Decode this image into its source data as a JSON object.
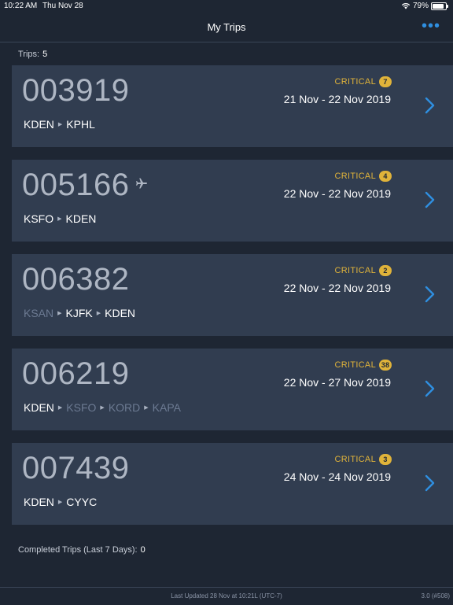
{
  "status_bar": {
    "time": "10:22 AM",
    "date": "Thu Nov 28",
    "battery": "79%"
  },
  "nav": {
    "title": "My Trips",
    "more_icon": "more-dots-icon"
  },
  "trips_count": {
    "label": "Trips:",
    "value": "5"
  },
  "trips": [
    {
      "number": "003919",
      "status": "CRITICAL",
      "critical_count": "7",
      "dates": "21 Nov - 22 Nov 2019",
      "in_flight": false,
      "route": [
        {
          "code": "KDEN",
          "active": true
        },
        {
          "code": "KPHL",
          "active": true
        }
      ]
    },
    {
      "number": "005166",
      "status": "CRITICAL",
      "critical_count": "4",
      "dates": "22 Nov - 22 Nov 2019",
      "in_flight": true,
      "route": [
        {
          "code": "KSFO",
          "active": true
        },
        {
          "code": "KDEN",
          "active": true
        }
      ]
    },
    {
      "number": "006382",
      "status": "CRITICAL",
      "critical_count": "2",
      "dates": "22 Nov - 22 Nov 2019",
      "in_flight": false,
      "route": [
        {
          "code": "KSAN",
          "active": false
        },
        {
          "code": "KJFK",
          "active": true
        },
        {
          "code": "KDEN",
          "active": true
        }
      ]
    },
    {
      "number": "006219",
      "status": "CRITICAL",
      "critical_count": "38",
      "dates": "22 Nov - 27 Nov 2019",
      "in_flight": false,
      "route": [
        {
          "code": "KDEN",
          "active": true
        },
        {
          "code": "KSFO",
          "active": false
        },
        {
          "code": "KORD",
          "active": false
        },
        {
          "code": "KAPA",
          "active": false
        }
      ]
    },
    {
      "number": "007439",
      "status": "CRITICAL",
      "critical_count": "3",
      "dates": "24 Nov - 24 Nov 2019",
      "in_flight": false,
      "route": [
        {
          "code": "KDEN",
          "active": true
        },
        {
          "code": "CYYC",
          "active": true
        }
      ]
    }
  ],
  "completed": {
    "label": "Completed Trips (Last 7 Days):",
    "value": "0"
  },
  "footer": {
    "updated": "Last Updated 28 Nov at 10:21L (UTC-7)",
    "version": "3.0 (#508)"
  },
  "colors": {
    "background": "#1e2633",
    "card": "#313d50",
    "accent": "#2f8fe0",
    "critical": "#e0b33a",
    "inactive_airport": "#6c7a92"
  }
}
